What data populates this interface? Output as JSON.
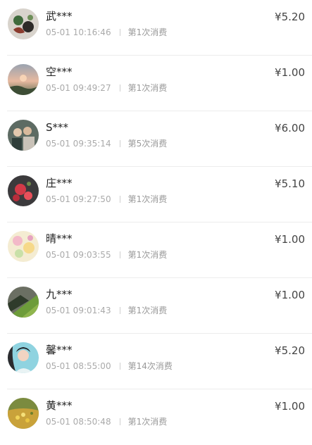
{
  "records": [
    {
      "name": "武***",
      "time": "05-01 10:16:46",
      "count": "第1次消费",
      "amount": "¥5.20",
      "avatar": "art-painting"
    },
    {
      "name": "空***",
      "time": "05-01 09:49:27",
      "count": "第1次消费",
      "amount": "¥1.00",
      "avatar": "sunset-landscape"
    },
    {
      "name": "S***",
      "time": "05-01 09:35:14",
      "count": "第5次消费",
      "amount": "¥6.00",
      "avatar": "group-photo"
    },
    {
      "name": "庄***",
      "time": "05-01 09:27:50",
      "count": "第1次消费",
      "amount": "¥5.10",
      "avatar": "red-flowers"
    },
    {
      "name": "晴***",
      "time": "05-01 09:03:55",
      "count": "第1次消费",
      "amount": "¥1.00",
      "avatar": "pastel-flowers"
    },
    {
      "name": "九***",
      "time": "05-01 09:01:43",
      "count": "第1次消费",
      "amount": "¥1.00",
      "avatar": "green-hillside"
    },
    {
      "name": "馨***",
      "time": "05-01 08:55:00",
      "count": "第14次消费",
      "amount": "¥5.20",
      "avatar": "girl-portrait"
    },
    {
      "name": "黄***",
      "time": "05-01 08:50:48",
      "count": "第1次消费",
      "amount": "¥1.00",
      "avatar": "flower-field"
    }
  ]
}
